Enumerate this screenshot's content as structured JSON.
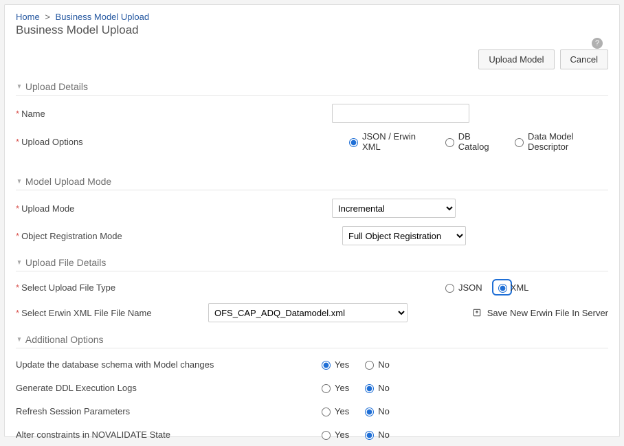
{
  "breadcrumb": {
    "home": "Home",
    "current": "Business Model Upload"
  },
  "page_title": "Business Model Upload",
  "help_tooltip": "?",
  "actions": {
    "upload": "Upload Model",
    "cancel": "Cancel"
  },
  "sections": {
    "upload_details": {
      "title": "Upload Details",
      "name_label": "Name",
      "name_value": "",
      "options_label": "Upload Options",
      "options": {
        "json_erwin": "JSON / Erwin XML",
        "db_catalog": "DB Catalog",
        "data_model_descriptor": "Data Model Descriptor"
      }
    },
    "model_upload_mode": {
      "title": "Model Upload Mode",
      "upload_mode_label": "Upload Mode",
      "upload_mode_value": "Incremental",
      "object_reg_label": "Object Registration Mode",
      "object_reg_value": "Full Object Registration"
    },
    "upload_file_details": {
      "title": "Upload File Details",
      "file_type_label": "Select Upload File Type",
      "file_type_options": {
        "json": "JSON",
        "xml": "XML"
      },
      "file_name_label": "Select Erwin XML File File Name",
      "file_name_value": "OFS_CAP_ADQ_Datamodel.xml",
      "save_server": "Save New Erwin File In Server"
    },
    "additional_options": {
      "title": "Additional Options",
      "rows": {
        "update_schema": "Update the database schema with Model changes",
        "gen_ddl": "Generate DDL Execution Logs",
        "refresh_session": "Refresh Session Parameters",
        "alter_constraints": "Alter constraints in NOVALIDATE State"
      },
      "yes": "Yes",
      "no": "No"
    }
  }
}
